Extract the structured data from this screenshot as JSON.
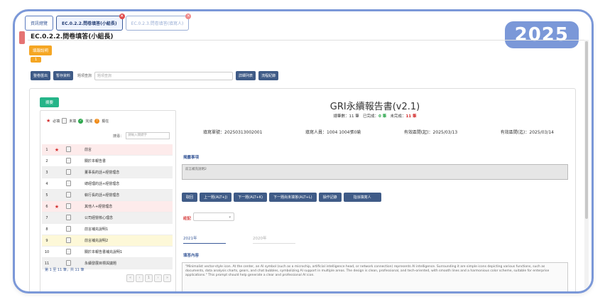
{
  "badge": {
    "year": "2025"
  },
  "tabs": [
    {
      "label": "資訊總覽",
      "state": "normal",
      "closable": false
    },
    {
      "label": "EC.0.2.2.問卷填答(小組長)",
      "state": "active",
      "closable": true
    },
    {
      "label": "EC.0.2.3.問卷填答(填寫人)",
      "state": "inactive",
      "closable": true
    }
  ],
  "page": {
    "title": "EC.0.2.2.問卷填答(小組長)"
  },
  "orange_button": "填報說明",
  "orange_badge": "1",
  "toolbar": {
    "export_label": "整卷匯出",
    "save_label": "暫存資料",
    "search_label": "題項查詢",
    "search_placeholder": "題項查詢",
    "detail_label": "詳細列表",
    "log_label": "流程紀錄"
  },
  "card": {
    "green_button": "摘要",
    "title": "GRI永續報告書(v2.1)",
    "stats": {
      "total_label": "總筆數：",
      "total": "11 筆",
      "done_label": "已完成：",
      "done": "0 筆",
      "undone_label": "未完成：",
      "undone": "11 筆"
    },
    "meta": {
      "unit": "填寫單號：20250313002001",
      "person": "填寫人員：1004 1004張0瑜",
      "start": "有效區間(起)：2025/03/13",
      "end": "有效區間(迄)：2025/03/14"
    },
    "desc_label": "揭露事項",
    "desc_text": "前言補充說明2",
    "nav_buttons": [
      "取回",
      "上一題(ALT+J)",
      "下一題(ALT+K)",
      "下一題尚未填答(ALT+L)",
      "操作記錄",
      "指派填寫人"
    ],
    "remark_label": "註記",
    "remark_value": "▾",
    "year_tabs": [
      "2021年",
      "2020年"
    ],
    "content_label": "填答內容",
    "content_text": "\"Minimalist vector-style icon. At the center, an AI symbol (such as a microchip, artificial intelligence head, or network connection) represents AI intelligence. Surrounding it are simple icons depicting various functions, such as documents, data analysis charts, gears, and chat bubbles, symbolizing AI support in multiple areas. The design is clean, professional, and tech-oriented, with smooth lines and a harmonious color scheme, suitable for enterprise applications.\" This prompt should help generate a clear and professional AI icon."
  },
  "legend": {
    "required": "必填",
    "unfilled": "未填",
    "done": "完成",
    "pending": "擬在"
  },
  "list_search_label": "搜尋：",
  "list_search_placeholder": "請輸入關鍵字",
  "list": [
    {
      "no": "1",
      "required": true,
      "name": "前言",
      "color": "pink"
    },
    {
      "no": "2",
      "required": false,
      "name": "關於本報告書",
      "color": "white"
    },
    {
      "no": "3",
      "required": false,
      "name": "董事長的話+經營理念",
      "color": "gray"
    },
    {
      "no": "4",
      "required": false,
      "name": "總經理的話+經營理念",
      "color": "white"
    },
    {
      "no": "5",
      "required": false,
      "name": "執行長的話+經營理念",
      "color": "gray"
    },
    {
      "no": "6",
      "required": true,
      "name": "其他人+經營理念",
      "color": "pink"
    },
    {
      "no": "7",
      "required": false,
      "name": "公司經營核心理念",
      "color": "gray"
    },
    {
      "no": "8",
      "required": false,
      "name": "前言補充說明1",
      "color": "white"
    },
    {
      "no": "9",
      "required": false,
      "name": "前言補充說明2",
      "color": "yellow"
    },
    {
      "no": "10",
      "required": false,
      "name": "關於本報告書補充說明1",
      "color": "white"
    },
    {
      "no": "11",
      "required": false,
      "name": "永續發展目標與議題",
      "color": "gray"
    }
  ],
  "list_footer": "第 1 至 11 筆，共 11 筆"
}
